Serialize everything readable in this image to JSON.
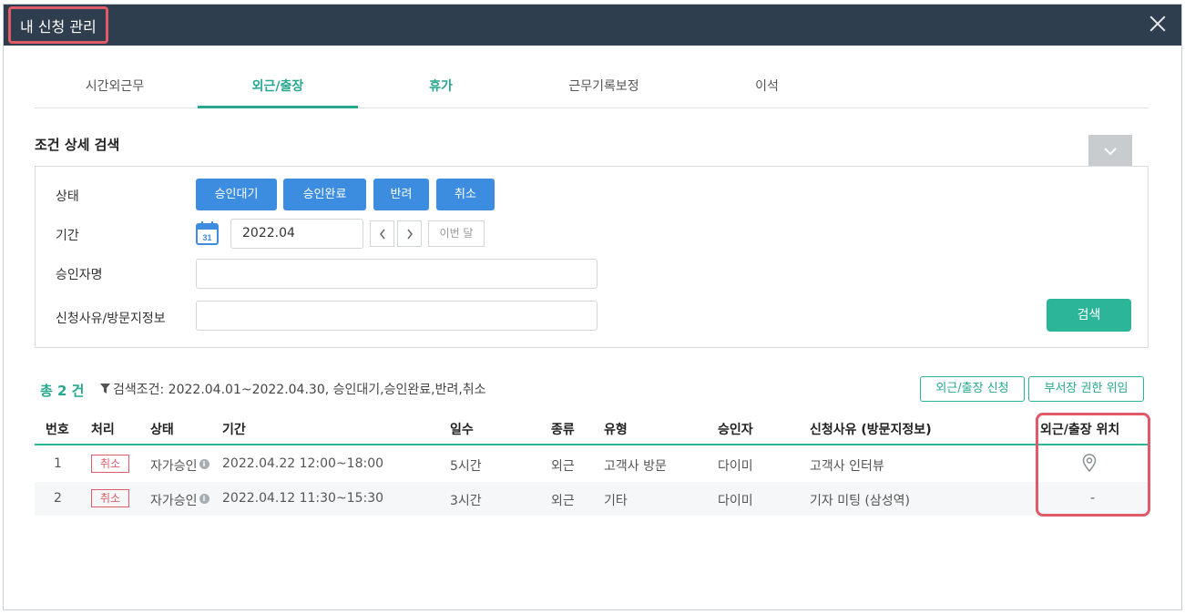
{
  "window": {
    "title": "내 신청 관리"
  },
  "tabs": [
    {
      "label": "시간외근무"
    },
    {
      "label": "외근/출장"
    },
    {
      "label": "휴가"
    },
    {
      "label": "근무기록보정"
    },
    {
      "label": "이석"
    }
  ],
  "search": {
    "title": "조건 상세 검색",
    "status_label": "상태",
    "status_buttons": [
      "승인대기",
      "승인완료",
      "반려",
      "취소"
    ],
    "period_label": "기간",
    "period_value": "2022.04",
    "calendar_day": "31",
    "this_month": "이번 달",
    "approver_label": "승인자명",
    "reason_label": "신청사유/방문지정보",
    "search_button": "검색"
  },
  "summary": {
    "total": "총 2 건",
    "filter": "검색조건: 2022.04.01~2022.04.30, 승인대기,승인완료,반려,취소"
  },
  "actions": {
    "apply": "외근/출장 신청",
    "delegate": "부서장 권한 위임"
  },
  "table": {
    "headers": [
      "번호",
      "처리",
      "상태",
      "기간",
      "일수",
      "종류",
      "유형",
      "승인자",
      "신청사유 (방문지정보)",
      "외근/출장 위치"
    ],
    "rows": [
      {
        "no": "1",
        "action": "취소",
        "status": "자가승인",
        "period": "2022.04.22 12:00~18:00",
        "days": "5시간",
        "kind": "외근",
        "type": "고객사 방문",
        "approver": "다이미",
        "reason": "고객사 인터뷰",
        "location_icon": "map-pin-icon"
      },
      {
        "no": "2",
        "action": "취소",
        "status": "자가승인",
        "period": "2022.04.12 11:30~15:30",
        "days": "3시간",
        "kind": "외근",
        "type": "기타",
        "approver": "다이미",
        "reason": "기자 미팅 (삼성역)",
        "location": "-"
      }
    ]
  },
  "colors": {
    "titlebar": "#2f3e4e",
    "accent": "#27a88e",
    "primary_button": "#3c8de0",
    "highlight": "#e05a67"
  }
}
